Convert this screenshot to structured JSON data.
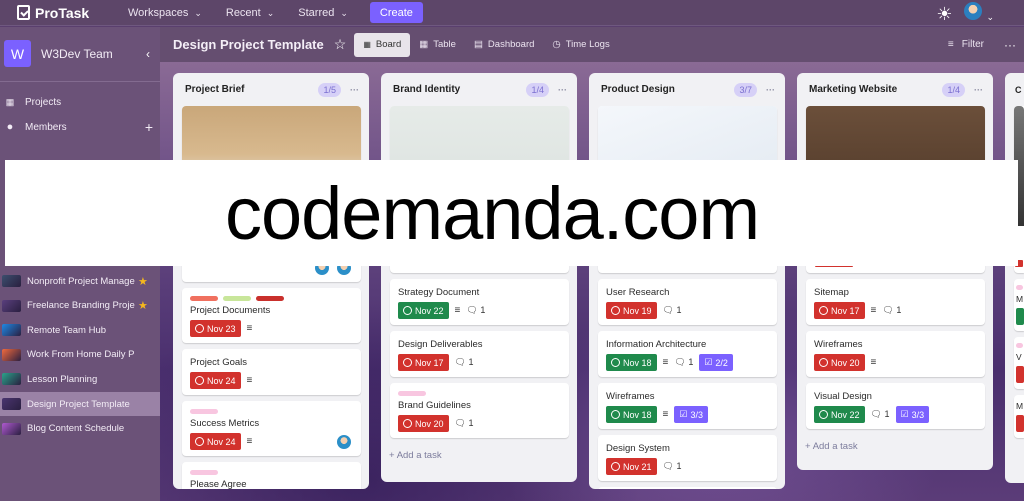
{
  "topbar": {
    "app_name": "ProTask",
    "menus": [
      {
        "label": "Workspaces"
      },
      {
        "label": "Recent"
      },
      {
        "label": "Starred"
      }
    ],
    "create_label": "Create",
    "theme_icon": "sun-icon"
  },
  "sidebar": {
    "workspace_initial": "W",
    "workspace_name": "W3Dev Team",
    "nav": [
      {
        "label": "Projects"
      },
      {
        "label": "Members"
      }
    ],
    "boards": [
      {
        "label": "Nonprofit Project Management",
        "starred": true,
        "color": "#3c4f6e"
      },
      {
        "label": "Freelance Branding Project",
        "starred": true,
        "color": "#5a3f7e"
      },
      {
        "label": "Remote Team Hub",
        "starred": false,
        "color": "#1e88e5"
      },
      {
        "label": "Work From Home Daily Planner",
        "starred": false,
        "color": "#f26a3d"
      },
      {
        "label": "Lesson Planning",
        "starred": false,
        "color": "#2aa38a"
      },
      {
        "label": "Design Project Template",
        "starred": false,
        "color": "#4a3570",
        "active": true
      },
      {
        "label": "Blog Content Schedule",
        "starred": false,
        "color": "#b05ad0"
      }
    ]
  },
  "board": {
    "title": "Design Project Template",
    "views": [
      {
        "label": "Board",
        "active": true
      },
      {
        "label": "Table"
      },
      {
        "label": "Dashboard"
      },
      {
        "label": "Time Logs"
      }
    ],
    "filter_label": "Filter"
  },
  "colors": {
    "red": "#d2322d",
    "green": "#1f8a4c",
    "purple": "#7b61ff"
  },
  "columns": [
    {
      "title": "Project Brief",
      "count": "1/5",
      "cards": [
        {
          "title": "Project Documents",
          "labels": [
            "#f0705f",
            "#c8e69a",
            "#c9302c"
          ],
          "due": "Nov 23",
          "due_color": "red",
          "desc": true
        },
        {
          "title": "Project Goals",
          "due": "Nov 24",
          "due_color": "red",
          "desc": true
        },
        {
          "title": "Success Metrics",
          "labels": [
            "#f8c6e0"
          ],
          "due": "Nov 24",
          "due_color": "red",
          "desc": true,
          "avatar": true
        },
        {
          "title": "Please Agree",
          "labels": [
            "#f8c6e0"
          ]
        }
      ]
    },
    {
      "title": "Brand Identity",
      "count": "1/4",
      "cards": [
        {
          "title": "Strategy Document",
          "due": "Nov 22",
          "due_color": "green",
          "desc": true,
          "comments": "1"
        },
        {
          "title": "Design Deliverables",
          "due": "Nov 17",
          "due_color": "red",
          "comments": "1"
        },
        {
          "title": "Brand Guidelines",
          "labels": [
            "#f8c6e0"
          ],
          "due": "Nov 20",
          "due_color": "red",
          "comments": "1"
        }
      ],
      "add_label": "Add a task"
    },
    {
      "title": "Product Design",
      "count": "3/7",
      "cards": [
        {
          "title": "User Research",
          "due": "Nov 19",
          "due_color": "red",
          "comments": "1"
        },
        {
          "title": "Information Architecture",
          "due": "Nov 18",
          "due_color": "green",
          "desc": true,
          "comments": "1",
          "checklist": "2/2"
        },
        {
          "title": "Wireframes",
          "due": "Nov 18",
          "due_color": "green",
          "desc": true,
          "checklist": "3/3"
        },
        {
          "title": "Design System",
          "due": "Nov 21",
          "due_color": "red",
          "comments": "1"
        },
        {
          "title": ""
        }
      ]
    },
    {
      "title": "Marketing Website",
      "count": "1/4",
      "cards": [
        {
          "title": "Sitemap",
          "due": "Nov 17",
          "due_color": "red",
          "desc": true,
          "comments": "1"
        },
        {
          "title": "Wireframes",
          "due": "Nov 20",
          "due_color": "red",
          "desc": true
        },
        {
          "title": "Visual Design",
          "due": "Nov 22",
          "due_color": "green",
          "comments": "1",
          "checklist": "3/3"
        }
      ],
      "add_label": "Add a task"
    },
    {
      "title": "C",
      "count": "",
      "cards": [
        {
          "title": "M",
          "labels": [
            "#f8c6e0"
          ],
          "due": "",
          "due_color": "green"
        },
        {
          "title": "V",
          "labels": [
            "#f8c6e0"
          ],
          "due": "",
          "due_color": "red"
        },
        {
          "title": "M",
          "due": "",
          "due_color": "red"
        }
      ]
    }
  ],
  "watermark": "codemanda.com"
}
